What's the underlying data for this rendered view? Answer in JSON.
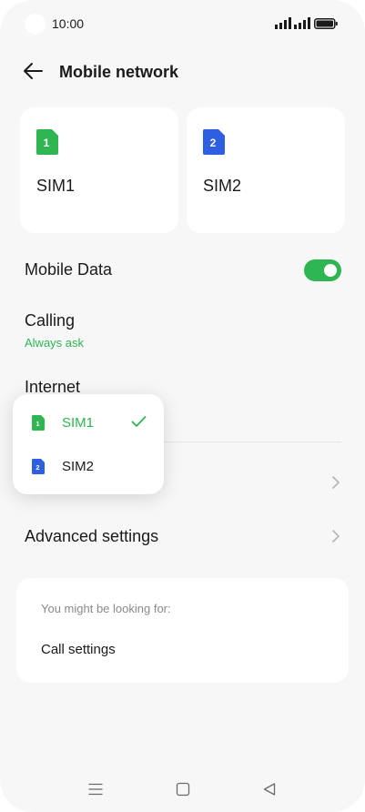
{
  "status_bar": {
    "time": "10:00"
  },
  "header": {
    "title": "Mobile network"
  },
  "sim_cards": [
    {
      "label": "SIM1",
      "number": "1",
      "color": "#2fb552"
    },
    {
      "label": "SIM2",
      "number": "2",
      "color": "#2d5fe0"
    }
  ],
  "settings": {
    "mobile_data": {
      "label": "Mobile Data",
      "enabled": true
    },
    "calling": {
      "label": "Calling",
      "value": "Always ask"
    },
    "internet": {
      "label": "Internet"
    },
    "advanced": {
      "label": "Advanced settings"
    }
  },
  "internet_popup": {
    "options": [
      {
        "label": "SIM1",
        "number": "1",
        "selected": true
      },
      {
        "label": "SIM2",
        "number": "2",
        "selected": false
      }
    ]
  },
  "suggestions": {
    "heading": "You might be looking for:",
    "items": [
      "Call settings"
    ]
  },
  "colors": {
    "accent": "#2fb552",
    "sim2": "#2d5fe0",
    "background": "#f7f7f7",
    "card": "#ffffff"
  },
  "icons": {
    "back": "arrow-left-icon",
    "check": "check-icon",
    "chevron": "chevron-right-icon",
    "nav": [
      "menu-icon",
      "home-icon",
      "back-triangle-icon"
    ]
  }
}
